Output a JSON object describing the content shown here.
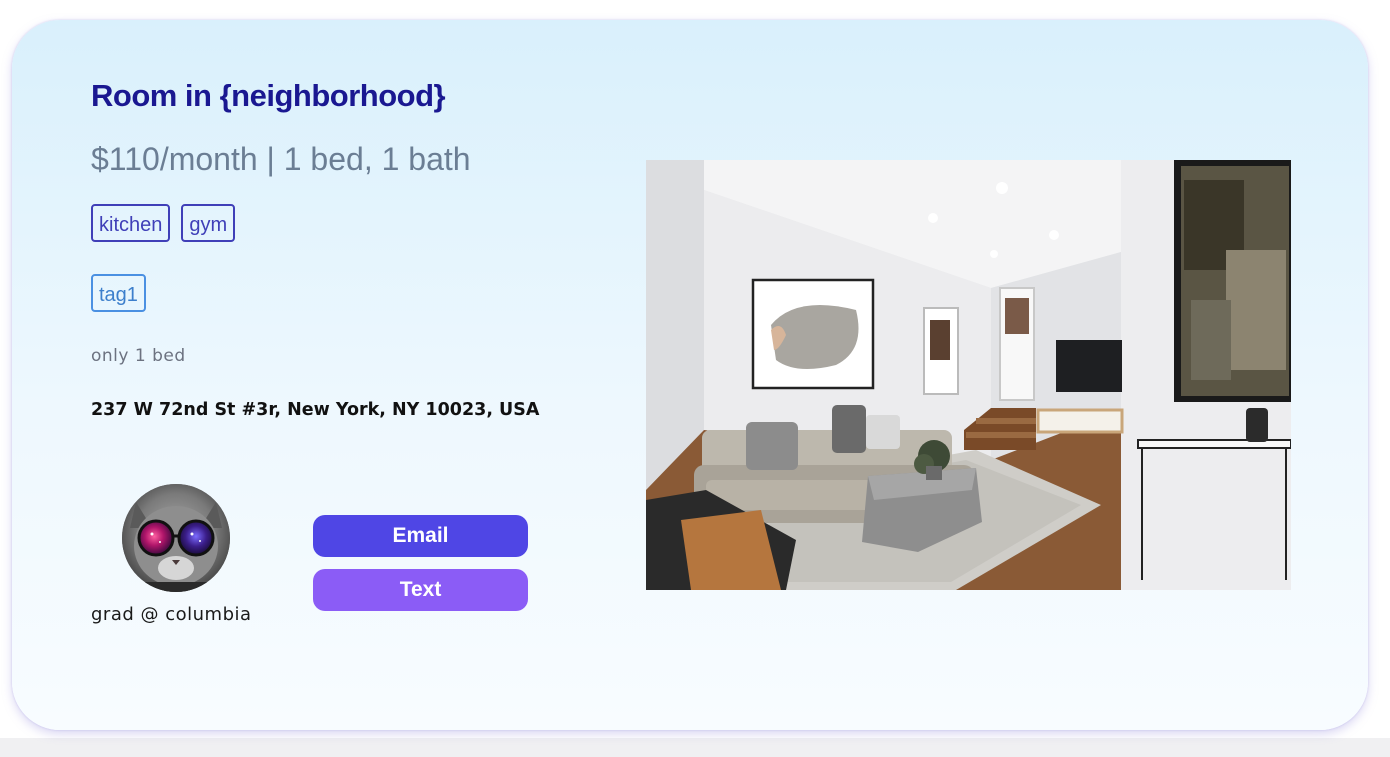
{
  "listing": {
    "title": "Room in {neighborhood}",
    "price_line": "$110/month | 1 bed, 1 bath",
    "amenity_tags": [
      "kitchen",
      "gym"
    ],
    "custom_tags": [
      "tag1"
    ],
    "note": "only 1 bed",
    "address": "237 W 72nd St #3r, New York, NY 10023, USA"
  },
  "host": {
    "label": "grad @ columbia",
    "avatar_icon": "cat-with-galaxy-sunglasses"
  },
  "actions": {
    "email_label": "Email",
    "text_label": "Text"
  },
  "photo": {
    "subject": "living-room-photo"
  },
  "colors": {
    "title": "#1a1891",
    "email_button": "#4f46e5",
    "text_button": "#8b5cf6",
    "amenity_tag": "#3f3fb8",
    "custom_tag": "#4a90e2"
  }
}
